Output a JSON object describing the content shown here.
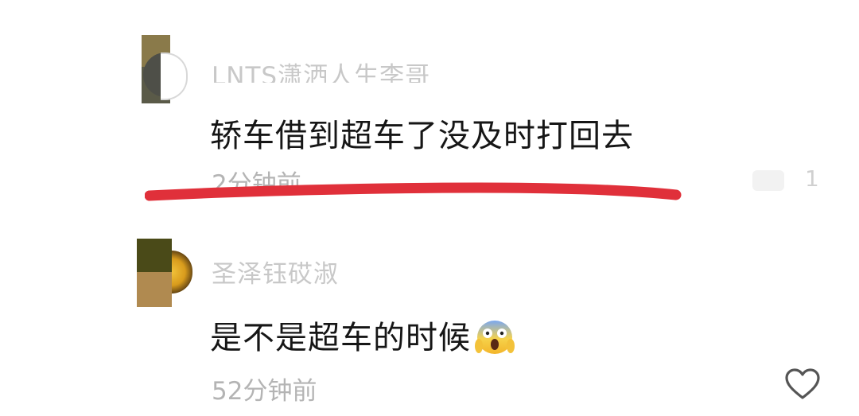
{
  "comments": [
    {
      "username": "LNTS潇洒人生李哥",
      "text": "轿车借到超车了没及时打回去",
      "time": "2分钟前",
      "like_count": "1"
    },
    {
      "username": "圣泽钰砹淑",
      "text": "是不是超车的时候",
      "emoji": "face-screaming-in-fear",
      "time": "52分钟前"
    }
  ],
  "annotation": {
    "underline_color": "#e0303a"
  },
  "icons": {
    "like": "heart-outline-icon"
  }
}
